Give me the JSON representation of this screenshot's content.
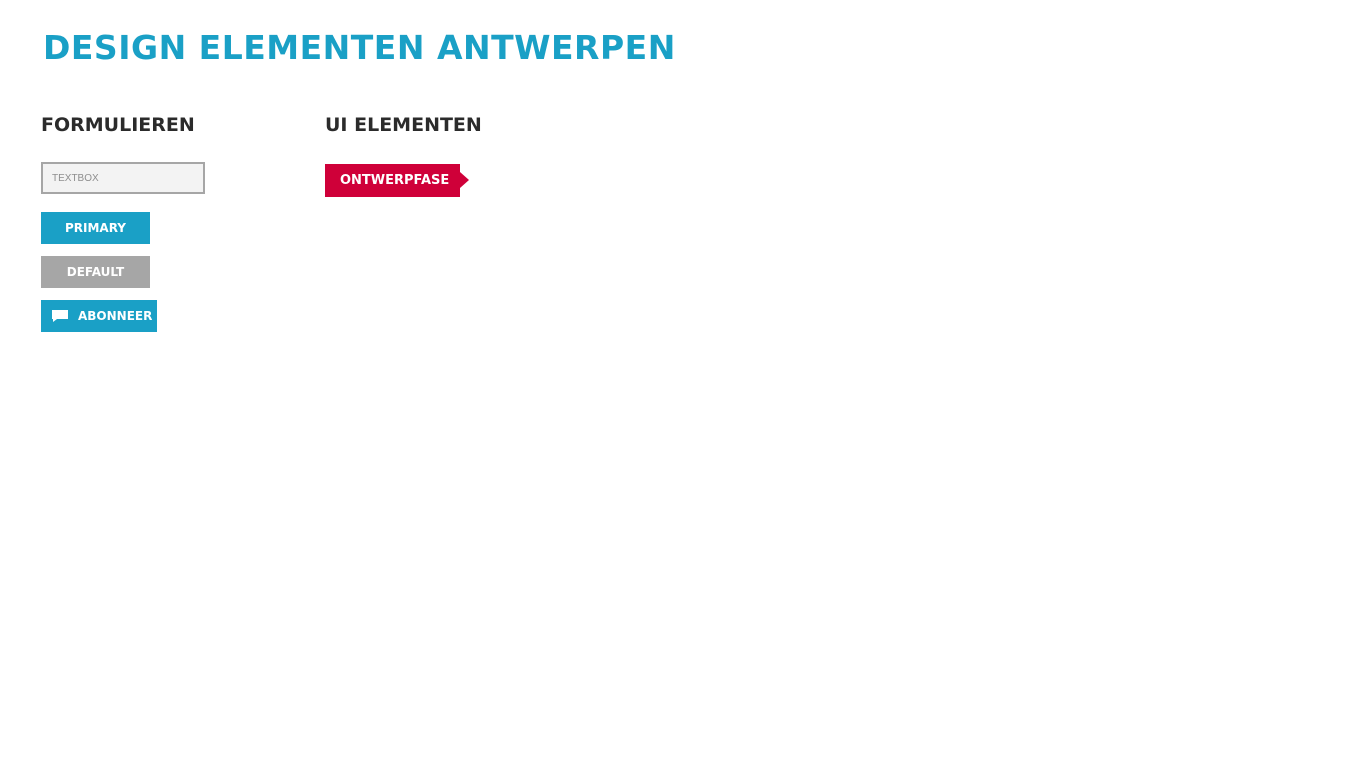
{
  "header": {
    "title": "Design elementen Antwerpen"
  },
  "forms": {
    "heading": "Formulieren",
    "textbox_placeholder": "Textbox",
    "primary_label": "Primary",
    "default_label": "Default",
    "subscribe_label": "Abonneer",
    "subscribe_icon": "chat-bubble-icon"
  },
  "ui_elements": {
    "heading": "UI elementen",
    "phase_tag_label": "Ontwerpfase"
  },
  "colors": {
    "accent": "#1aa0c6",
    "default_button": "#a6a6a6",
    "phase_tag": "#cf0039",
    "heading_text": "#2b2b2b"
  }
}
